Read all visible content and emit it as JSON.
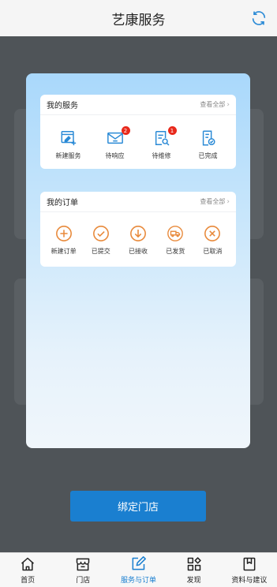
{
  "header": {
    "title": "艺康服务",
    "refresh_icon": "refresh-icon"
  },
  "modal": {
    "services": {
      "title": "我的服务",
      "view_all": "查看全部",
      "items": [
        {
          "label": "新建服务",
          "icon": "new-service-icon"
        },
        {
          "label": "待响应",
          "icon": "mail-icon",
          "badge": "2"
        },
        {
          "label": "待维修",
          "icon": "repair-icon",
          "badge": "1"
        },
        {
          "label": "已完成",
          "icon": "completed-icon"
        }
      ]
    },
    "orders": {
      "title": "我的订单",
      "view_all": "查看全部",
      "items": [
        {
          "label": "新建订单",
          "icon": "plus-circle-icon"
        },
        {
          "label": "已提交",
          "icon": "check-circle-icon"
        },
        {
          "label": "已接收",
          "icon": "download-circle-icon"
        },
        {
          "label": "已发货",
          "icon": "truck-circle-icon"
        },
        {
          "label": "已取消",
          "icon": "x-circle-icon"
        }
      ]
    }
  },
  "bind_button": "绑定门店",
  "tabbar": {
    "tabs": [
      {
        "label": "首页",
        "icon": "home-icon"
      },
      {
        "label": "门店",
        "icon": "store-icon"
      },
      {
        "label": "服务与订单",
        "icon": "edit-icon",
        "active": true
      },
      {
        "label": "发现",
        "icon": "discover-icon"
      },
      {
        "label": "资料与建议",
        "icon": "bookmark-icon"
      }
    ]
  },
  "colors": {
    "primary": "#1a7fd0",
    "service_icon": "#2a8ad6",
    "order_icon": "#e8893a",
    "badge": "#e8291c"
  }
}
